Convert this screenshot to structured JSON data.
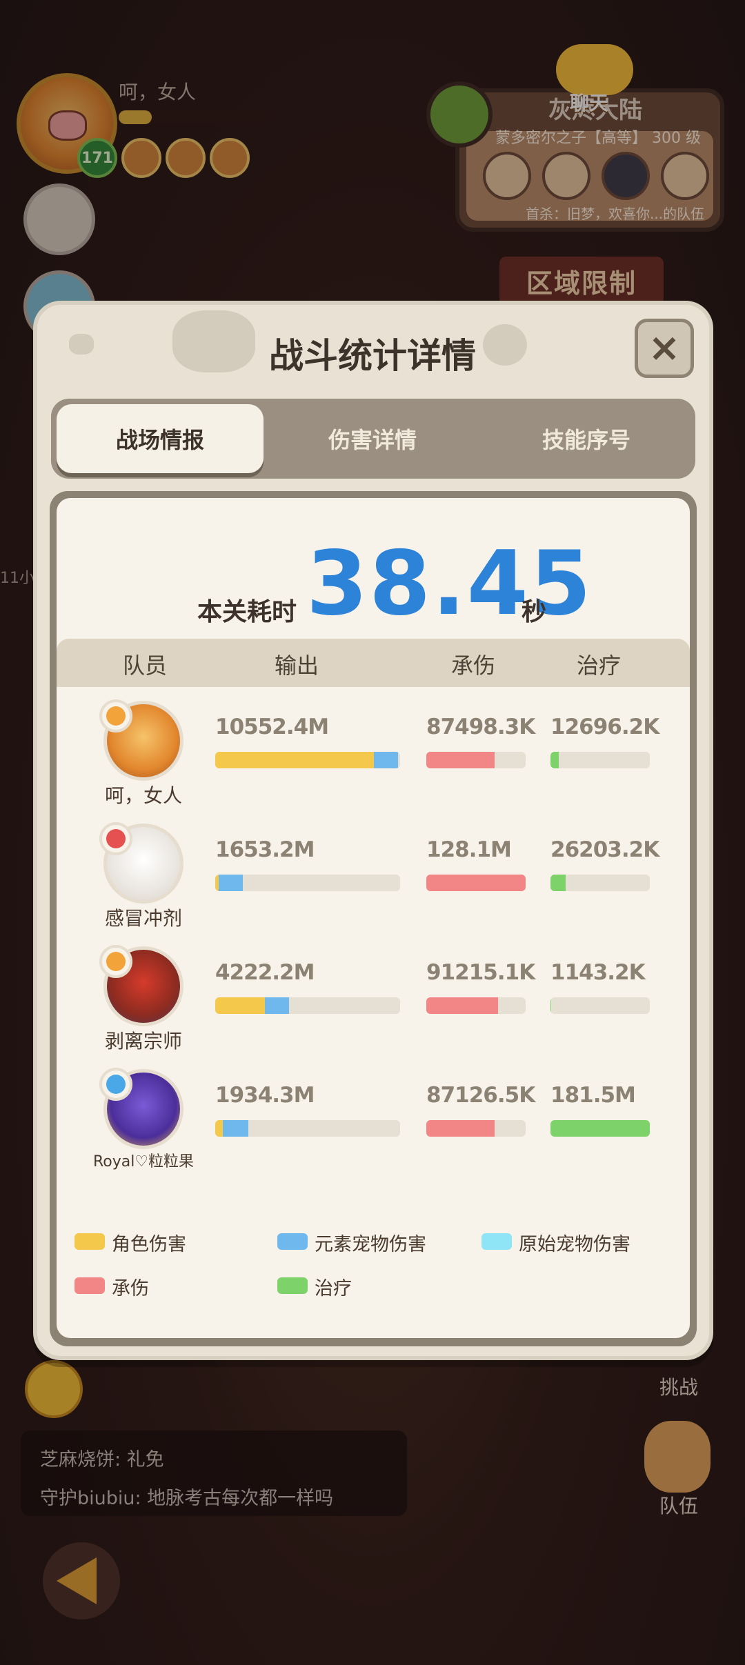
{
  "hud": {
    "player_name": "呵，女人",
    "level": "171",
    "chat_label": "聊天",
    "area_title": "灰烬大陆",
    "area_location": "蒙多密尔之子【高等】 300 级",
    "area_message": "首杀：旧梦，欢喜你...的队伍",
    "region_limit": "区域限制",
    "side_time": "11小"
  },
  "chat_log": [
    {
      "speaker": "芝麻烧饼",
      "text": "礼免",
      "line": "芝麻烧饼: 礼免"
    },
    {
      "speaker": "守护biubiu",
      "text": "地脉考古每次都一样吗",
      "line": "守护biubiu: 地脉考古每次都一样吗"
    }
  ],
  "right_buttons": {
    "challenge": "挑战",
    "team": "队伍"
  },
  "modal": {
    "title": "战斗统计详情",
    "tabs": [
      {
        "label": "战场情报",
        "active": true
      },
      {
        "label": "伤害详情",
        "active": false
      },
      {
        "label": "技能序号",
        "active": false
      }
    ],
    "time_label": "本关耗时",
    "time_value": "38.45",
    "time_unit": "秒",
    "columns": [
      "队员",
      "输出",
      "承伤",
      "治疗"
    ],
    "rows": [
      {
        "name": "呵，女人",
        "element": "fire",
        "output": "10552.4M",
        "tank": "87498.3K",
        "heal": "12696.2K",
        "output_split": {
          "role": 0.86,
          "element_pet": 0.13,
          "origin_pet": 0.0
        },
        "tank_fill": 0.69,
        "heal_fill": 0.08
      },
      {
        "name": "感冒冲剂",
        "element": "red",
        "output": "1653.2M",
        "tank": "128.1M",
        "heal": "26203.2K",
        "output_split": {
          "role": 0.02,
          "element_pet": 0.13,
          "origin_pet": 0.0
        },
        "tank_fill": 1.0,
        "heal_fill": 0.15
      },
      {
        "name": "剥离宗师",
        "element": "fire",
        "output": "4222.2M",
        "tank": "91215.1K",
        "heal": "1143.2K",
        "output_split": {
          "role": 0.27,
          "element_pet": 0.13,
          "origin_pet": 0.0
        },
        "tank_fill": 0.72,
        "heal_fill": 0.01
      },
      {
        "name": "Royal♡粒粒果",
        "element": "water",
        "output": "1934.3M",
        "tank": "87126.5K",
        "heal": "181.5M",
        "output_split": {
          "role": 0.04,
          "element_pet": 0.14,
          "origin_pet": 0.0
        },
        "tank_fill": 0.69,
        "heal_fill": 1.0
      }
    ],
    "legend": [
      {
        "label": "角色伤害",
        "color": "#f4c84a"
      },
      {
        "label": "元素宠物伤害",
        "color": "#6fb8ee"
      },
      {
        "label": "原始宠物伤害",
        "color": "#8fe4f6"
      },
      {
        "label": "承伤",
        "color": "#f28585"
      },
      {
        "label": "治疗",
        "color": "#7dd36a"
      }
    ]
  },
  "colors": {
    "time_accent": "#2c83d8",
    "role": "#f4c84a",
    "element_pet": "#6fb8ee",
    "origin_pet": "#8fe4f6",
    "tank": "#f28585",
    "heal": "#7dd36a"
  }
}
